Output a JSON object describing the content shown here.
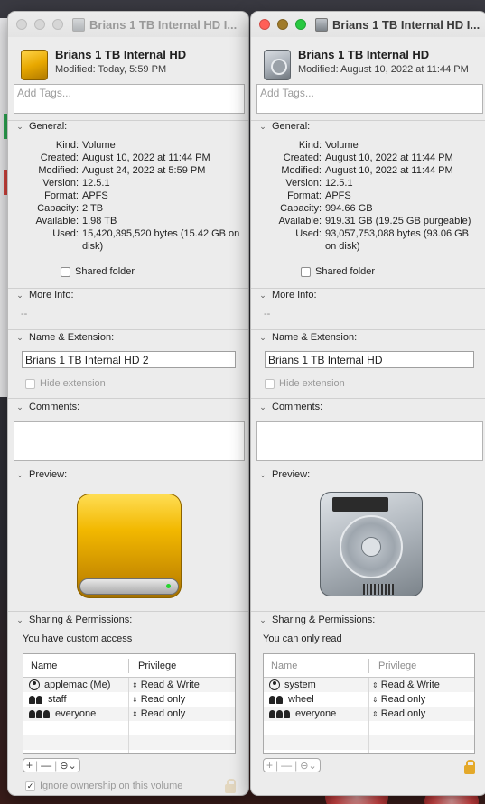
{
  "window_left": {
    "title": "Brians 1 TB Internal HD I...",
    "name": "Brians 1 TB Internal HD",
    "modified": "Modified: Today, 5:59 PM",
    "tags_placeholder": "Add Tags...",
    "sections": {
      "general": "General:",
      "more_info": "More Info:",
      "name_ext": "Name & Extension:",
      "comments": "Comments:",
      "preview": "Preview:",
      "sharing": "Sharing & Permissions:"
    },
    "general": [
      {
        "k": "Kind:",
        "v": "Volume"
      },
      {
        "k": "Created:",
        "v": "August 10, 2022 at 11:44 PM"
      },
      {
        "k": "Modified:",
        "v": "August 24, 2022 at 5:59 PM"
      },
      {
        "k": "Version:",
        "v": "12.5.1"
      },
      {
        "k": "Format:",
        "v": "APFS"
      },
      {
        "k": "Capacity:",
        "v": "2 TB"
      },
      {
        "k": "Available:",
        "v": "1.98 TB"
      },
      {
        "k": "Used:",
        "v": "15,420,395,520 bytes (15.42 GB on disk)"
      }
    ],
    "shared_folder": "Shared folder",
    "more_info_value": "--",
    "name_field": "Brians 1 TB Internal HD 2",
    "hide_extension": "Hide extension",
    "access_text": "You have custom access",
    "table_headers": {
      "name": "Name",
      "privilege": "Privilege"
    },
    "permissions": [
      {
        "name": "applemac (Me)",
        "privilege": "Read & Write",
        "icon": "user-icon"
      },
      {
        "name": "staff",
        "privilege": "Read only",
        "icon": "group-icon"
      },
      {
        "name": "everyone",
        "privilege": "Read only",
        "icon": "everyone-icon"
      }
    ],
    "tools": {
      "add": "+",
      "remove": "—",
      "action": "⊖⌄"
    },
    "ignore_ownership": "Ignore ownership on this volume"
  },
  "window_right": {
    "title": "Brians 1 TB Internal HD I...",
    "name": "Brians 1 TB Internal HD",
    "modified": "Modified: August 10, 2022 at 11:44 PM",
    "tags_placeholder": "Add Tags...",
    "sections": {
      "general": "General:",
      "more_info": "More Info:",
      "name_ext": "Name & Extension:",
      "comments": "Comments:",
      "preview": "Preview:",
      "sharing": "Sharing & Permissions:"
    },
    "general": [
      {
        "k": "Kind:",
        "v": "Volume"
      },
      {
        "k": "Created:",
        "v": "August 10, 2022 at 11:44 PM"
      },
      {
        "k": "Modified:",
        "v": "August 10, 2022 at 11:44 PM"
      },
      {
        "k": "Version:",
        "v": "12.5.1"
      },
      {
        "k": "Format:",
        "v": "APFS"
      },
      {
        "k": "Capacity:",
        "v": "994.66 GB"
      },
      {
        "k": "Available:",
        "v": "919.31 GB (19.25 GB purgeable)"
      },
      {
        "k": "Used:",
        "v": "93,057,753,088 bytes (93.06 GB on disk)"
      }
    ],
    "shared_folder": "Shared folder",
    "more_info_value": "--",
    "name_field": "Brians 1 TB Internal HD",
    "hide_extension": "Hide extension",
    "access_text": "You can only read",
    "table_headers": {
      "name": "Name",
      "privilege": "Privilege"
    },
    "permissions": [
      {
        "name": "system",
        "privilege": "Read & Write",
        "icon": "user-icon"
      },
      {
        "name": "wheel",
        "privilege": "Read only",
        "icon": "group-icon"
      },
      {
        "name": "everyone",
        "privilege": "Read only",
        "icon": "everyone-icon"
      }
    ],
    "tools": {
      "add": "+",
      "remove": "—",
      "action": "⊖⌄"
    }
  },
  "colors": {
    "close": "#ff5f57",
    "minimize": "#a07b2a",
    "zoom": "#28c840",
    "gold_drive": "#f2b800"
  }
}
